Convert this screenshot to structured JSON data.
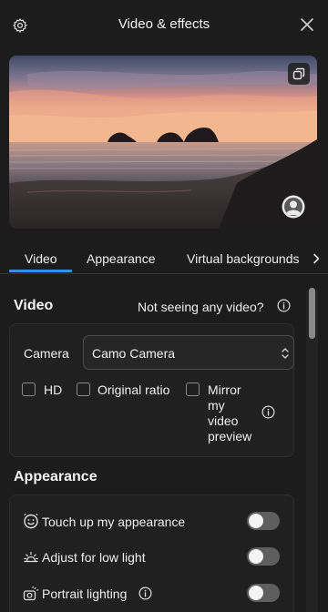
{
  "window": {
    "title": "Video & effects"
  },
  "tabs": [
    {
      "label": "Video"
    },
    {
      "label": "Appearance"
    },
    {
      "label": "Virtual backgrounds"
    }
  ],
  "video_section": {
    "title": "Video",
    "help_text": "Not seeing any video?",
    "camera_label": "Camera",
    "camera_value": "Camo Camera",
    "checkboxes": [
      {
        "label": "HD",
        "checked": false
      },
      {
        "label": "Original ratio",
        "checked": false
      },
      {
        "label": "Mirror my video preview",
        "line1": "Mirror",
        "line2": "my",
        "line3": "video",
        "line4": "preview",
        "checked": false
      }
    ]
  },
  "appearance_section": {
    "title": "Appearance",
    "rows": [
      {
        "label": "Touch up my appearance",
        "icon": "face-smile-icon",
        "enabled": false
      },
      {
        "label": "Adjust for low light",
        "icon": "sun-icon",
        "enabled": false
      },
      {
        "label": "Portrait lighting",
        "icon": "portrait-lighting-icon",
        "enabled": false
      }
    ]
  },
  "colors": {
    "accent": "#3a8cf0",
    "background": "#1c1c1c",
    "toggle_off": "#5e5e5e"
  }
}
